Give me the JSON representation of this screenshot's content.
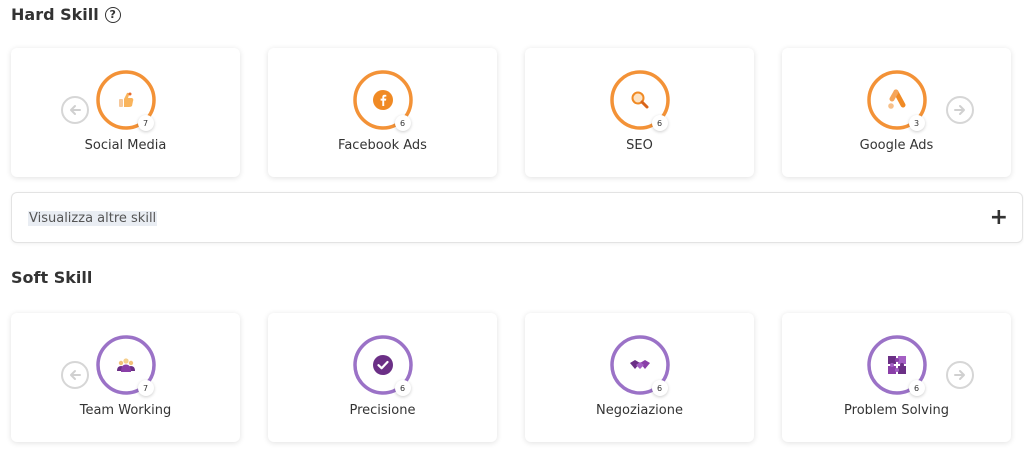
{
  "hard_skill": {
    "title": "Hard Skill",
    "help_icon": "?",
    "ring_color": "#f39237",
    "cards": [
      {
        "label": "Social Media",
        "count": "7",
        "icon": "thumbs-up-icon"
      },
      {
        "label": "Facebook Ads",
        "count": "6",
        "icon": "facebook-icon"
      },
      {
        "label": "SEO",
        "count": "6",
        "icon": "magnifier-icon"
      },
      {
        "label": "Google Ads",
        "count": "3",
        "icon": "google-ads-icon"
      }
    ]
  },
  "more": {
    "label": "Visualizza altre skill",
    "plus": "+"
  },
  "soft_skill": {
    "title": "Soft Skill",
    "ring_color": "#9b72c7",
    "cards": [
      {
        "label": "Team Working",
        "count": "7",
        "icon": "team-icon"
      },
      {
        "label": "Precisione",
        "count": "6",
        "icon": "check-badge-icon"
      },
      {
        "label": "Negoziazione",
        "count": "6",
        "icon": "handshake-icon"
      },
      {
        "label": "Problem Solving",
        "count": "6",
        "icon": "puzzle-icon"
      }
    ]
  }
}
